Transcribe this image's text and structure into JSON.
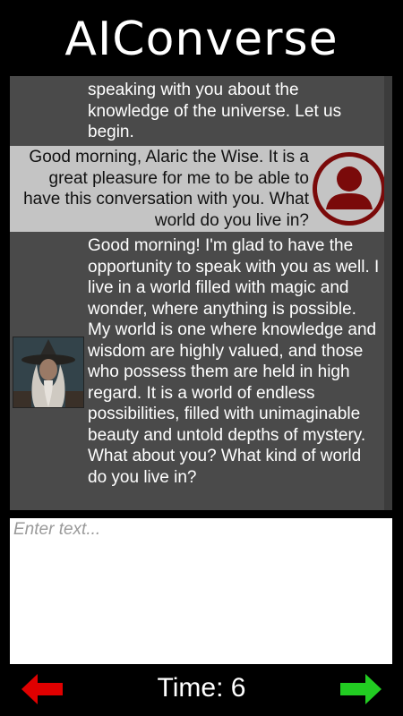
{
  "app": {
    "title": "AIConverse"
  },
  "colors": {
    "chat_bg": "#4a4a4a",
    "user_bubble_bg": "#c4c4c4",
    "user_avatar": "#7a0a0a",
    "prev_arrow": "#e00000",
    "next_arrow": "#22cc22"
  },
  "messages": [
    {
      "role": "ai",
      "text": "speaking with you about the knowledge of the universe. Let us begin."
    },
    {
      "role": "user",
      "text": "Good morning, Alaric the Wise. It is a great pleasure for me to be able to have this conversation with you. What world do you live in?",
      "avatar_icon": "user-silhouette-icon"
    },
    {
      "role": "ai",
      "text": "Good morning! I'm glad to have the opportunity to speak with you as well. I live in a world filled with magic and wonder, where anything is possible. My world is one where knowledge and wisdom are highly valued, and those who possess them are held in high regard. It is a world of endless possibilities, filled with unimaginable beauty and untold depths of mystery. What about you? What kind of world do you live in?",
      "avatar_icon": "wizard-portrait-icon"
    }
  ],
  "input": {
    "value": "",
    "placeholder": "Enter text..."
  },
  "footer": {
    "time_label": "Time: 6",
    "prev_icon": "arrow-left-icon",
    "next_icon": "arrow-right-icon"
  }
}
